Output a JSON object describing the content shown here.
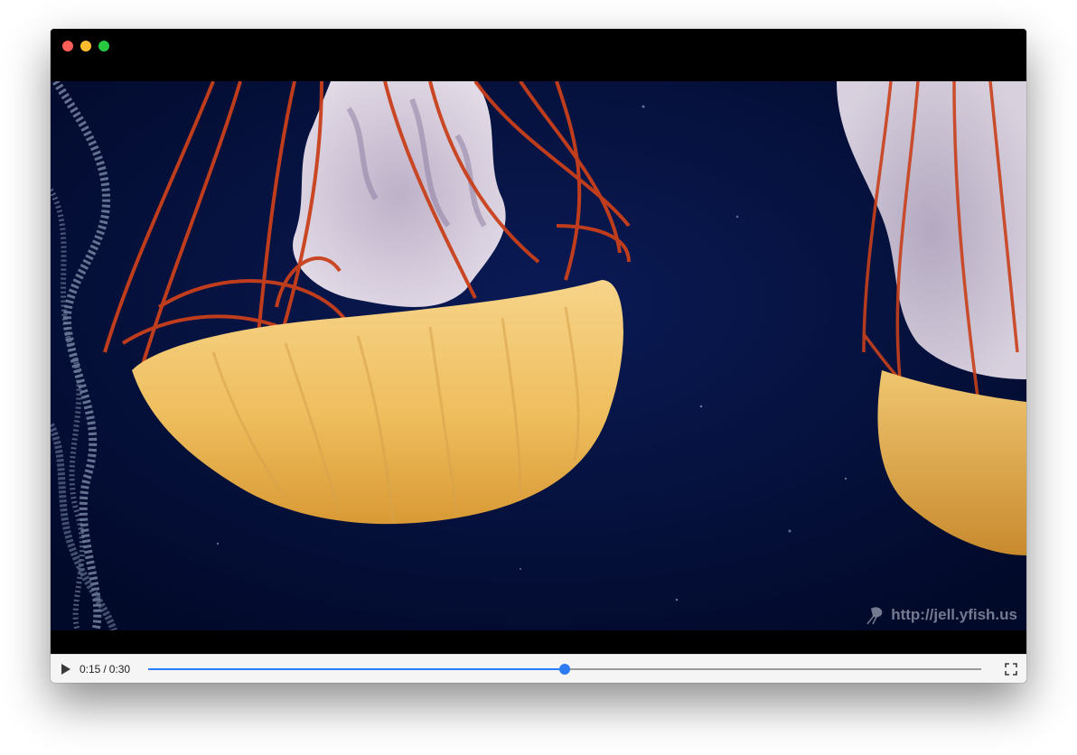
{
  "window": {
    "traffic_lights": {
      "close_color": "#ff5f57",
      "minimize_color": "#febc2e",
      "maximize_color": "#28c840"
    }
  },
  "video": {
    "watermark": "http://jell.yfish.us",
    "background_color": "#04103a"
  },
  "controls": {
    "play_icon": "play-icon",
    "current_time": "0:15",
    "separator": "/",
    "duration": "0:30",
    "progress_fraction": 0.5,
    "accent_color": "#2b7cf6",
    "fullscreen_icon": "fullscreen-icon"
  }
}
